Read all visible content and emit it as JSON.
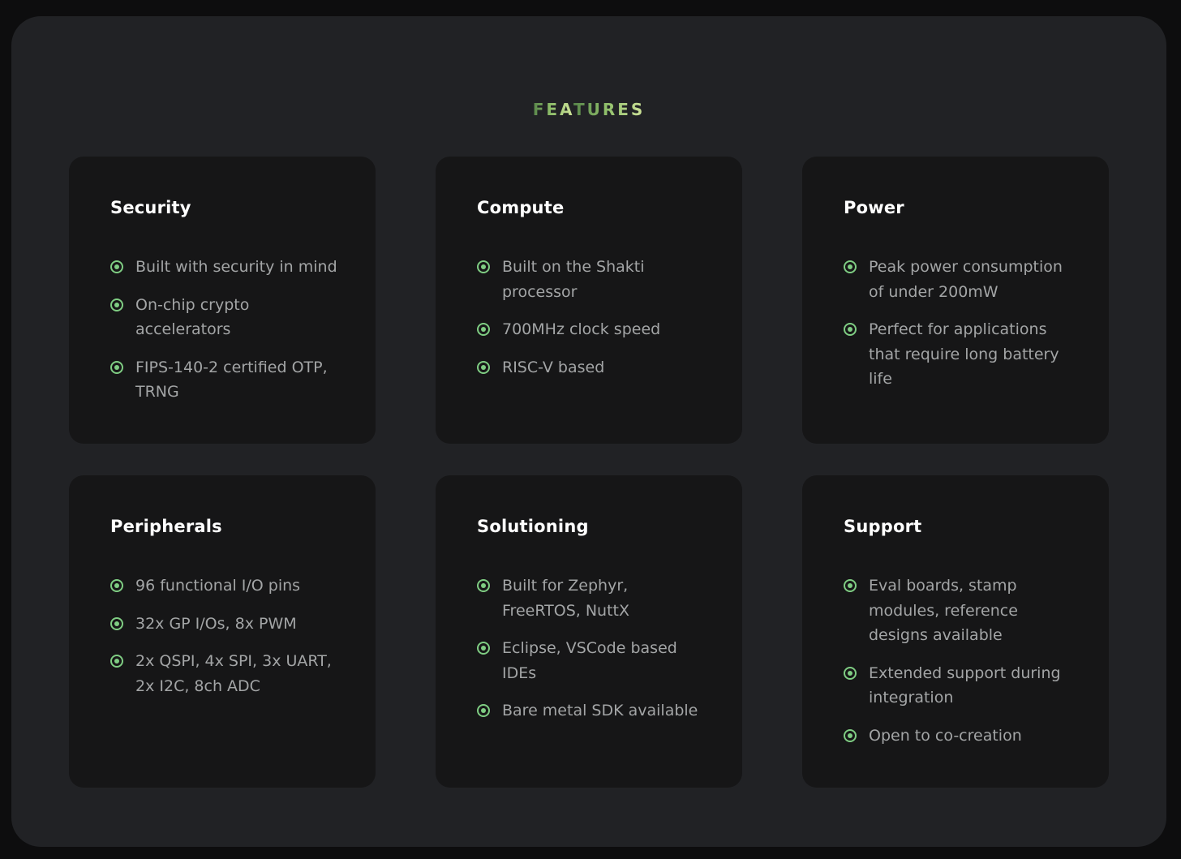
{
  "section": {
    "title_part1": "FEA",
    "title_part2": "TURES"
  },
  "colors": {
    "accent": "#7fcd83",
    "panel_bg": "#212225",
    "card_bg": "#161617",
    "title_gradient": [
      "#58864a",
      "#cfe39a"
    ]
  },
  "cards": [
    {
      "title": "Security",
      "items": [
        "Built with security in mind",
        "On-chip crypto accelerators",
        "FIPS-140-2 certified OTP, TRNG"
      ]
    },
    {
      "title": "Compute",
      "items": [
        "Built on the Shakti processor",
        "700MHz clock speed",
        "RISC-V based"
      ]
    },
    {
      "title": "Power",
      "items": [
        "Peak power consumption of under 200mW",
        "Perfect for applications that require long battery life"
      ]
    },
    {
      "title": "Peripherals",
      "items": [
        "96 functional I/O pins",
        "32x GP I/Os, 8x PWM",
        "2x QSPI, 4x SPI, 3x UART, 2x I2C, 8ch ADC"
      ]
    },
    {
      "title": "Solutioning",
      "items": [
        "Built for Zephyr, FreeRTOS, NuttX",
        "Eclipse, VSCode based IDEs",
        "Bare metal SDK available"
      ]
    },
    {
      "title": "Support",
      "items": [
        "Eval boards, stamp modules, reference designs available",
        "Extended support during integration",
        "Open to co-creation"
      ]
    }
  ]
}
